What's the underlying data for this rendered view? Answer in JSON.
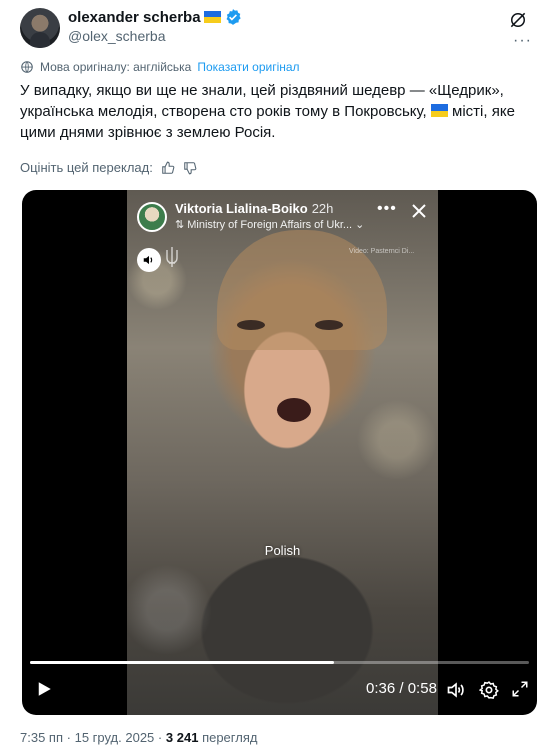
{
  "author": {
    "name": "olexander scherba",
    "handle": "@olex_scherba",
    "flag_colors": [
      "#1d6ce0",
      "#f6cc1c"
    ]
  },
  "translation": {
    "note": "Мова оригіналу: англійська",
    "show_original": "Показати оригінал"
  },
  "tweet": {
    "text_part1": "У випадку, якщо ви ще не знали, цей різдвяний шедевр — «Щедрик», українська мелодія, створена сто років тому в Покровську,",
    "text_part2": " місті, яке цими днями зрівнює з землею Росія."
  },
  "rate_translation": {
    "label": "Оцініть цей переклад:"
  },
  "video": {
    "story": {
      "author": "Viktoria Lialina-Boiko",
      "time": "22h",
      "source": "Ministry of Foreign Affairs of Ukr...",
      "watermark": "Video: Pasternci Di..."
    },
    "caption": "Polish",
    "current_time": "0:36",
    "separator": "/",
    "duration": "0:58",
    "progress_fraction": 0.61
  },
  "meta": {
    "time": "7:35 пп",
    "dot": "·",
    "date": "15 груд. 2025",
    "views_count": "3 241",
    "views_label": "перегляд"
  },
  "colors": {
    "accent": "#1d9bf0",
    "secondary_text": "#536471",
    "primary_text": "#0f1419"
  }
}
